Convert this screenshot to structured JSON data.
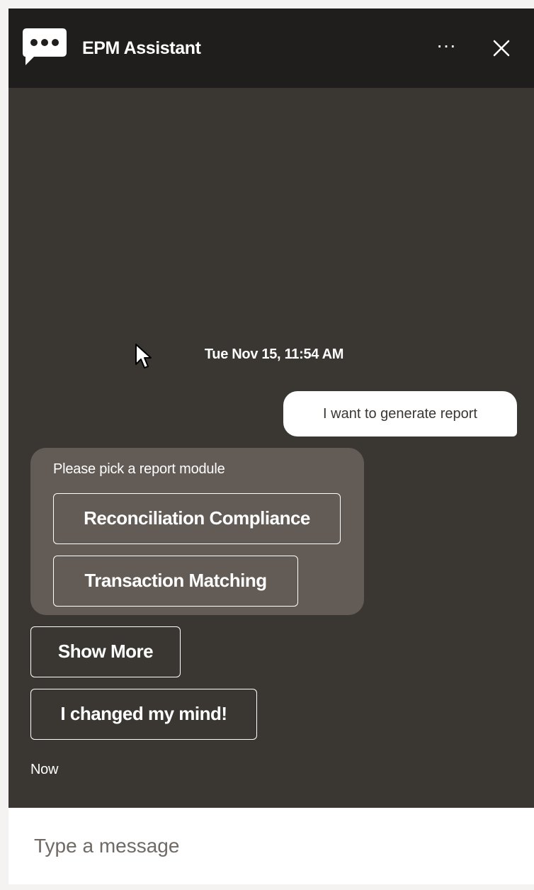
{
  "header": {
    "title": "EPM Assistant",
    "more_label": "···",
    "icons": {
      "logo": "chat-bubble-icon",
      "more": "ellipsis-icon",
      "close": "close-icon"
    }
  },
  "conversation": {
    "date_header": "Tue Nov 15, 11:54 AM",
    "user_message": "I want to generate report",
    "bot_prompt": "Please pick a report module",
    "options": [
      "Reconciliation Compliance",
      "Transaction Matching"
    ],
    "actions": {
      "show_more": "Show More",
      "changed_mind": "I changed my mind!"
    },
    "timestamp": "Now"
  },
  "composer": {
    "placeholder": "Type a message"
  },
  "colors": {
    "header_bg": "#201e1c",
    "body_bg": "#3a3632",
    "bot_bubble_bg": "#635c56",
    "user_bubble_bg": "#ffffff",
    "text_light": "#ffffff"
  }
}
